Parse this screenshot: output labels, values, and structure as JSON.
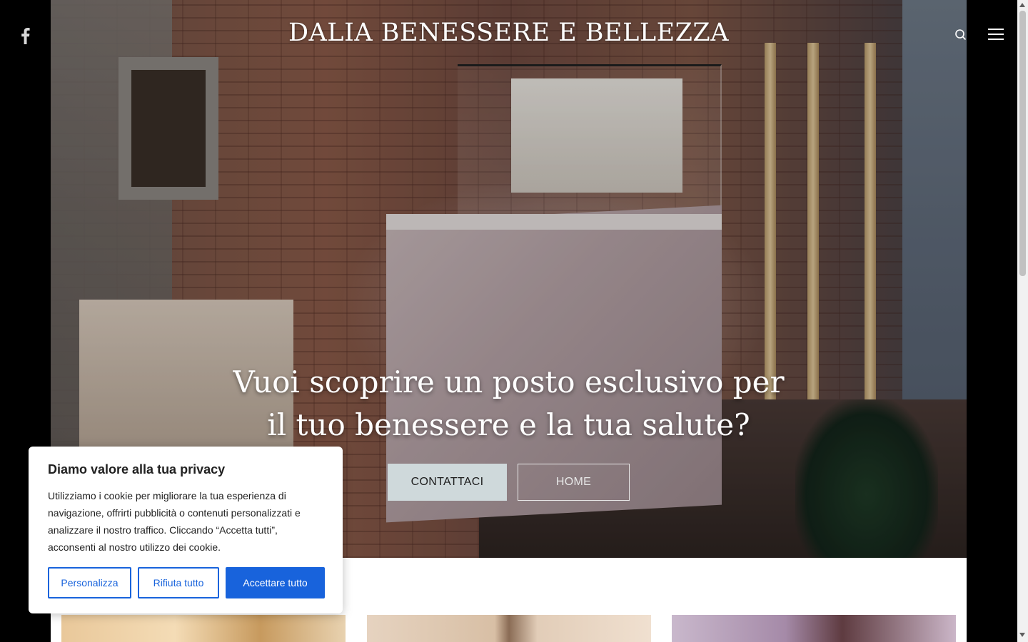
{
  "header": {
    "site_title": "DALIA BENESSERE E BELLEZZA",
    "social_icon": "facebook-icon",
    "search_icon": "search-icon",
    "menu_icon": "hamburger-menu-icon"
  },
  "hero": {
    "heading_line1": "Vuoi scoprire un posto esclusivo per",
    "heading_line2": "il tuo benessere e la tua salute?",
    "contact_button": "CONTATTACI",
    "home_button": "HOME"
  },
  "cookie_banner": {
    "title": "Diamo valore alla tua privacy",
    "text": "Utilizziamo i cookie per migliorare la tua esperienza di navigazione, offrirti pubblicità o contenuti personalizzati e analizzare il nostro traffico. Cliccando “Accetta tutti”, acconsenti al nostro utilizzo dei cookie.",
    "customize_button": "Personalizza",
    "reject_button": "Rifiuta tutto",
    "accept_button": "Accettare tutto",
    "accent_color": "#1863dc"
  }
}
